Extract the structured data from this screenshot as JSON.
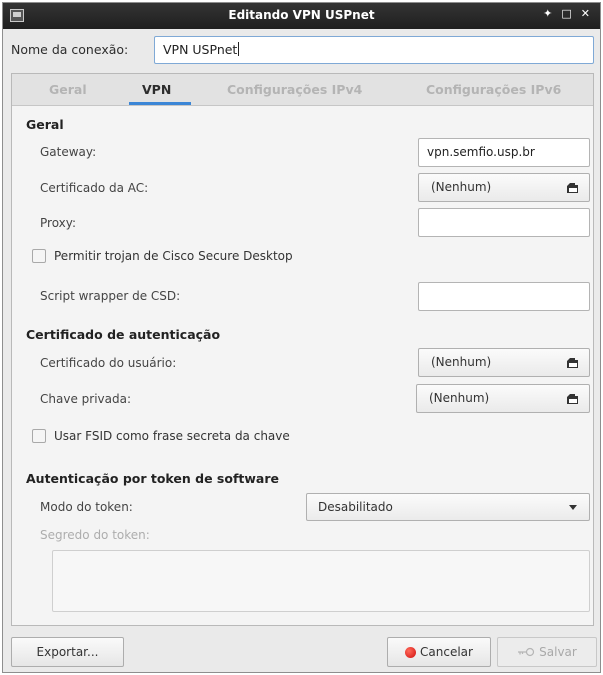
{
  "window": {
    "title": "Editando VPN USPnet",
    "controls": {
      "pin": "✦",
      "maximize": "□",
      "close": "✕"
    }
  },
  "connection": {
    "label": "Nome da conexão:",
    "value": "VPN USPnet"
  },
  "tabs": [
    {
      "label": "Geral",
      "active": false
    },
    {
      "label": "VPN",
      "active": true
    },
    {
      "label": "Configurações IPv4",
      "active": false
    },
    {
      "label": "Configurações IPv6",
      "active": false
    }
  ],
  "geral": {
    "title": "Geral",
    "gateway_label": "Gateway:",
    "gateway_value": "vpn.semfio.usp.br",
    "ca_cert_label": "Certificado da AC:",
    "ca_cert_value": "(Nenhum)",
    "proxy_label": "Proxy:",
    "proxy_value": "",
    "trojan_label": "Permitir trojan de Cisco Secure Desktop",
    "csd_label": "Script wrapper de CSD:",
    "csd_value": ""
  },
  "auth_cert": {
    "title": "Certificado de autenticação",
    "user_cert_label": "Certificado do usuário:",
    "user_cert_value": "(Nenhum)",
    "private_key_label": "Chave privada:",
    "private_key_value": "(Nenhum)",
    "fsid_label": "Usar FSID como frase secreta da chave"
  },
  "token": {
    "title": "Autenticação por token de software",
    "mode_label": "Modo do token:",
    "mode_value": "Desabilitado",
    "secret_label": "Segredo do token:"
  },
  "buttons": {
    "export": "Exportar...",
    "cancel": "Cancelar",
    "save": "Salvar"
  },
  "colors": {
    "accent": "#3b86d6",
    "titlebar": "#2a2a2a",
    "cancel_icon": "#d10f0f"
  }
}
